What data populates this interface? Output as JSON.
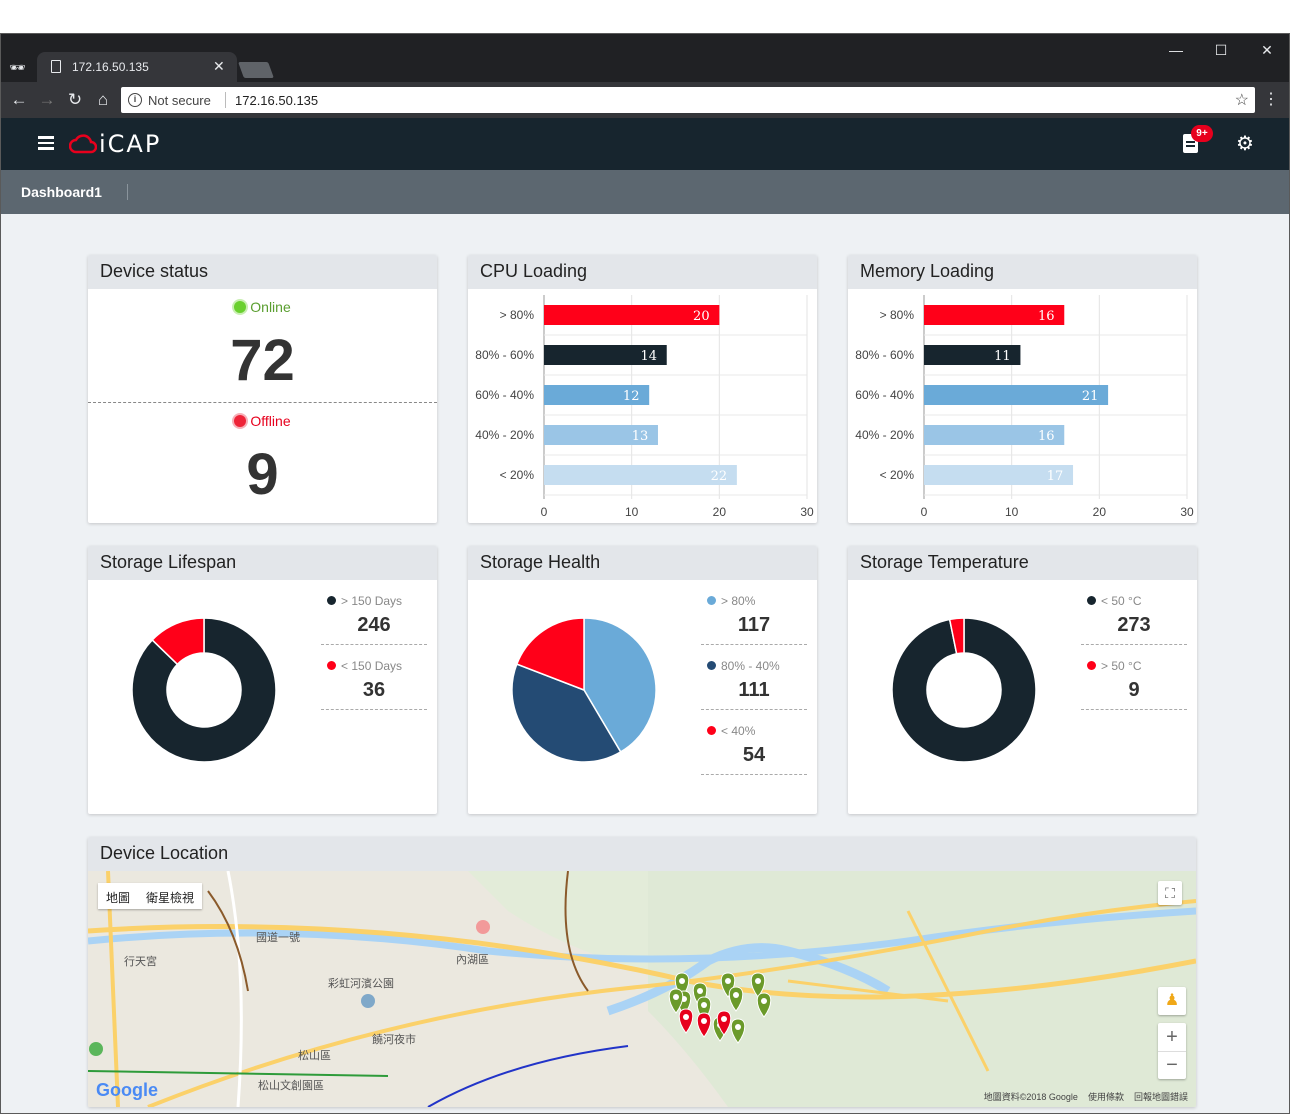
{
  "browser": {
    "tab_title": "172.16.50.135",
    "security_text": "Not secure",
    "url": "172.16.50.135"
  },
  "app": {
    "logo_text": "iCAP",
    "notification_badge": "9+",
    "dashboard_title": "Dashboard1"
  },
  "device_status": {
    "title": "Device status",
    "online_label": "Online",
    "online_count": "72",
    "offline_label": "Offline",
    "offline_count": "9"
  },
  "cpu_loading": {
    "title": "CPU Loading",
    "chart_data": {
      "type": "bar",
      "orientation": "horizontal",
      "categories": [
        "> 80%",
        "80% - 60%",
        "60% - 40%",
        "40% - 20%",
        "< 20%"
      ],
      "values": [
        20,
        14,
        12,
        13,
        22
      ],
      "colors": [
        "#ff0019",
        "#17252e",
        "#6aaad8",
        "#9ac5e6",
        "#c5ddf0"
      ],
      "xlim": [
        0,
        30
      ],
      "xticks": [
        0,
        10,
        20,
        30
      ]
    }
  },
  "memory_loading": {
    "title": "Memory Loading",
    "chart_data": {
      "type": "bar",
      "orientation": "horizontal",
      "categories": [
        "> 80%",
        "80% - 60%",
        "60% - 40%",
        "40% - 20%",
        "< 20%"
      ],
      "values": [
        16,
        11,
        21,
        16,
        17
      ],
      "colors": [
        "#ff0019",
        "#17252e",
        "#6aaad8",
        "#9ac5e6",
        "#c5ddf0"
      ],
      "xlim": [
        0,
        30
      ],
      "xticks": [
        0,
        10,
        20,
        30
      ]
    }
  },
  "storage_lifespan": {
    "title": "Storage Lifespan",
    "chart_data": {
      "type": "pie",
      "donut": true,
      "labels": [
        "> 150 Days",
        "< 150 Days"
      ],
      "values": [
        246,
        36
      ],
      "colors": [
        "#17252e",
        "#ff0019"
      ]
    }
  },
  "storage_health": {
    "title": "Storage Health",
    "chart_data": {
      "type": "pie",
      "donut": false,
      "labels": [
        "> 80%",
        "80% - 40%",
        "< 40%"
      ],
      "values": [
        117,
        111,
        54
      ],
      "colors": [
        "#6aaad8",
        "#244b74",
        "#ff0019"
      ]
    }
  },
  "storage_temperature": {
    "title": "Storage Temperature",
    "chart_data": {
      "type": "pie",
      "donut": true,
      "labels": [
        "< 50 °C",
        "> 50 °C"
      ],
      "values": [
        273,
        9
      ],
      "colors": [
        "#17252e",
        "#ff0019"
      ]
    }
  },
  "device_location": {
    "title": "Device Location",
    "map_type_map": "地圖",
    "map_type_satellite": "衛星檢視",
    "attribution": "地圖資料©2018 Google",
    "terms": "使用條款",
    "report": "回報地圖錯誤",
    "places": [
      "行天宮",
      "彩虹河濱公園",
      "內湖區",
      "饒河夜市",
      "松山區",
      "松山文創園區",
      "國道一號"
    ]
  }
}
